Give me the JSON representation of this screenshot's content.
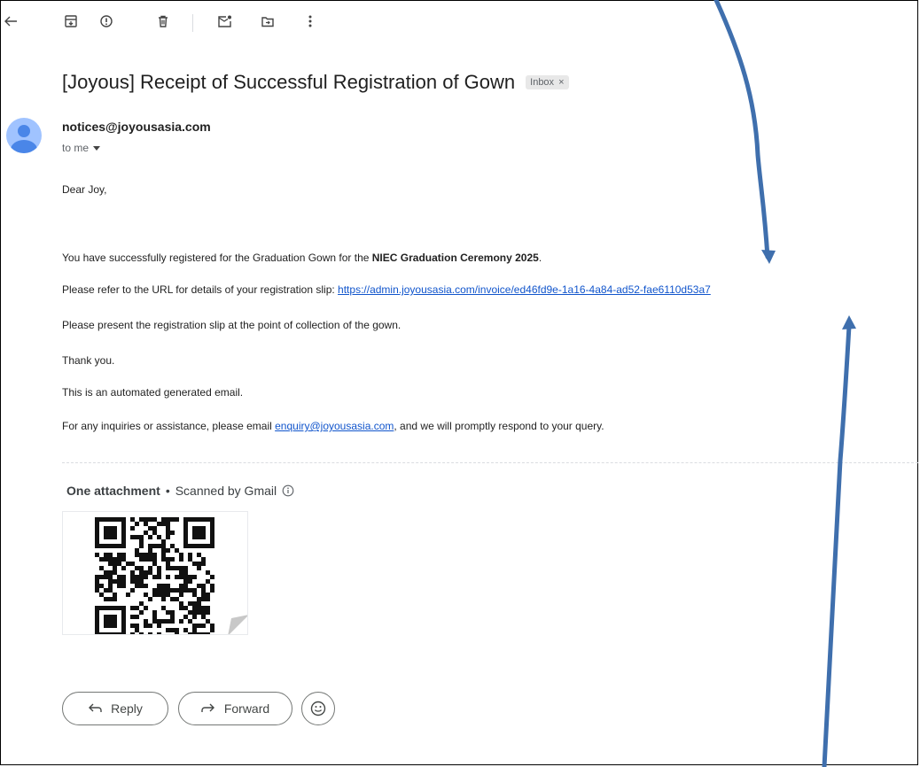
{
  "subject": "[Joyous] Receipt of Successful Registration of Gown",
  "label_badge": "Inbox",
  "label_close": "×",
  "sender": "notices@joyousasia.com",
  "recipient_line": "to me",
  "body": {
    "greeting": "Dear Joy,",
    "line1_prefix": "You have successfully registered for the Graduation Gown for the ",
    "line1_bold": "NIEC Graduation Ceremony 2025",
    "line1_suffix": ".",
    "line2_prefix": "Please refer to the URL for details of your registration slip: ",
    "line2_link": "https://admin.joyousasia.com/invoice/ed46fd9e-1a16-4a84-ad52-fae6110d53a7",
    "line3": "Please present the registration slip at the point of collection of the gown.",
    "line4": "Thank you.",
    "line5": "This is an automated generated email.",
    "line6_prefix": "For any inquiries or assistance, please email ",
    "line6_link": "enquiry@joyousasia.com",
    "line6_suffix": ", and we will promptly respond to your query."
  },
  "attachments": {
    "title": "One attachment",
    "dot": "•",
    "scan_note": "Scanned by Gmail",
    "file": "qr-code-image"
  },
  "actions": {
    "reply": "Reply",
    "forward": "Forward"
  },
  "icons": {
    "back": "arrow-back-icon",
    "archive": "archive-icon",
    "spam": "report-spam-icon",
    "delete": "delete-icon",
    "unread": "mark-unread-icon",
    "move": "move-to-icon",
    "more": "more-vert-icon",
    "info": "info-icon",
    "dropdown": "caret-down-icon",
    "emoji": "emoji-icon"
  },
  "colors": {
    "link": "#1155cc",
    "annotation_arrow": "#3f6fad",
    "avatar_bg": "#a0c3ff",
    "avatar_fg": "#4a86e8"
  }
}
